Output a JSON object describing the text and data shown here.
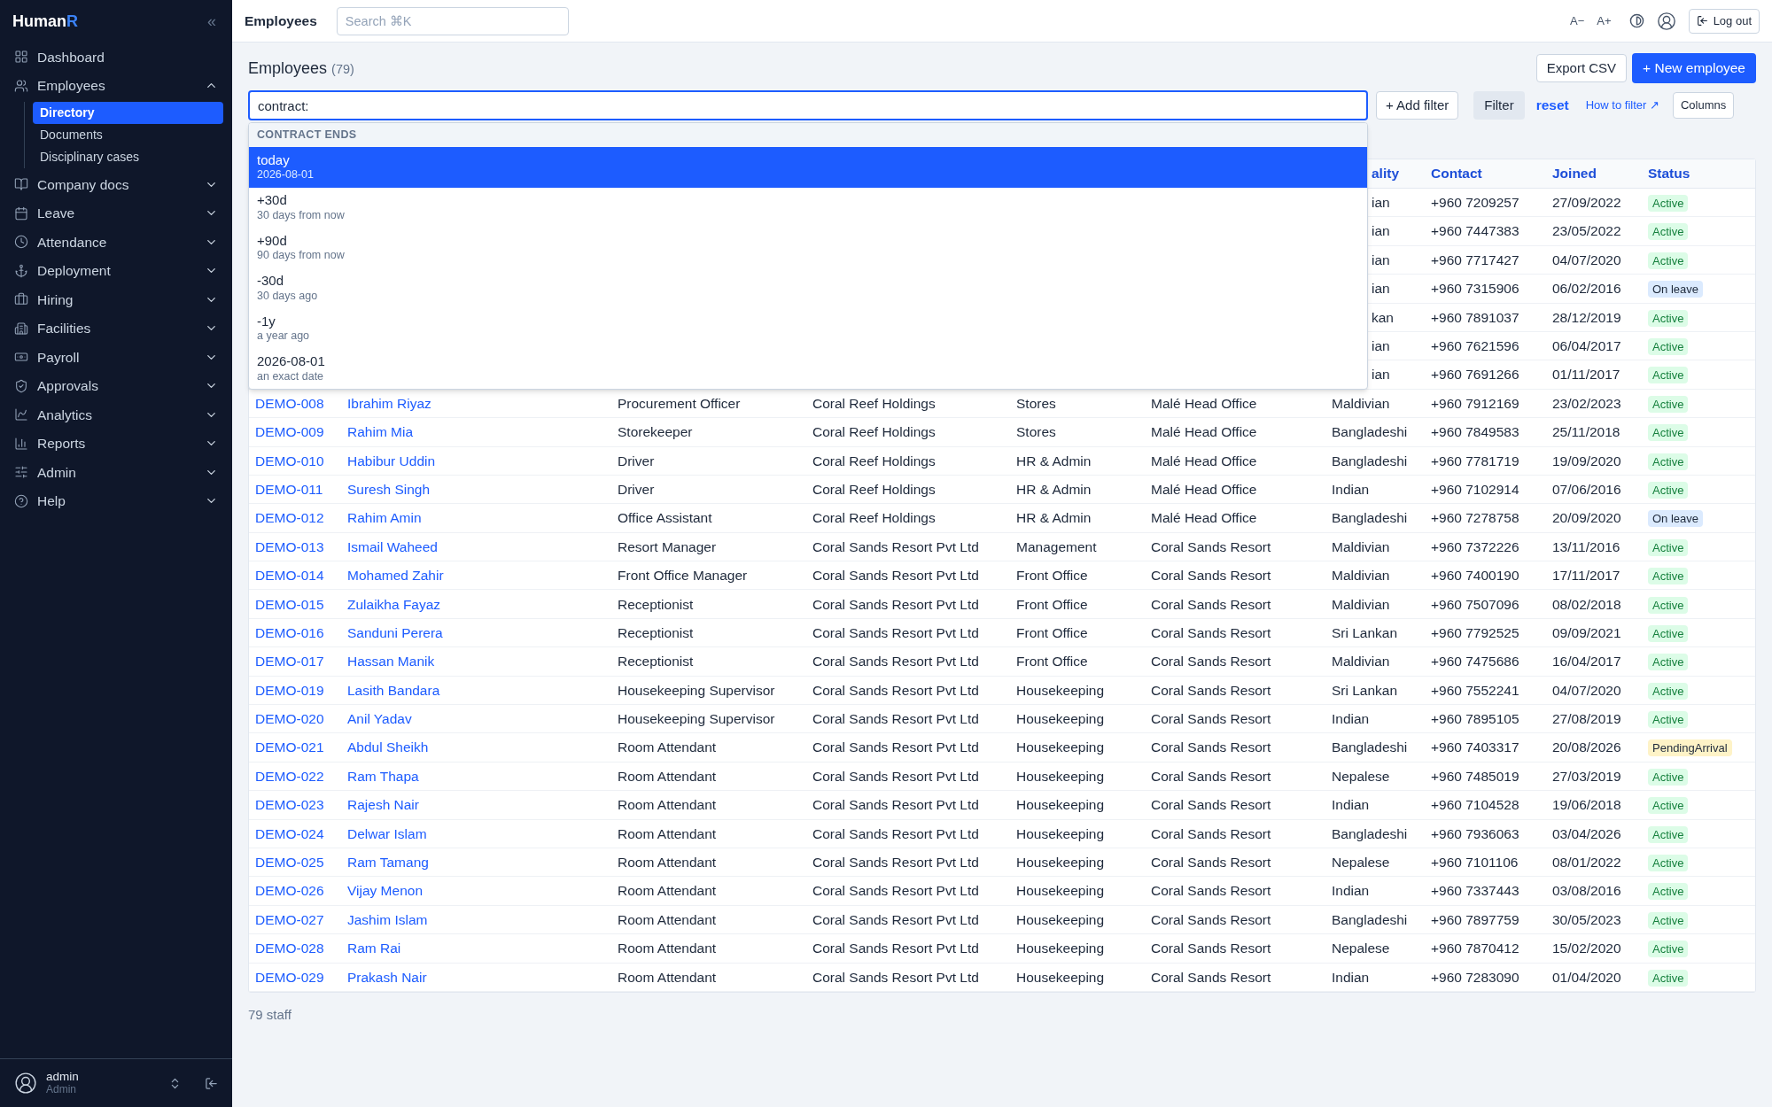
{
  "app": {
    "logo_main": "Human",
    "logo_accent": "R",
    "collapse": "«"
  },
  "sidebar": {
    "items": [
      {
        "label": "Dashboard"
      },
      {
        "label": "Employees",
        "expanded": true,
        "children": [
          {
            "label": "Directory",
            "selected": true
          },
          {
            "label": "Documents",
            "selected": false
          },
          {
            "label": "Disciplinary cases",
            "selected": false
          }
        ]
      },
      {
        "label": "Company docs",
        "expanded": false
      },
      {
        "label": "Leave",
        "expanded": false
      },
      {
        "label": "Attendance",
        "expanded": false
      },
      {
        "label": "Deployment",
        "expanded": false
      },
      {
        "label": "Hiring",
        "expanded": false
      },
      {
        "label": "Facilities",
        "expanded": false
      },
      {
        "label": "Payroll",
        "expanded": false
      },
      {
        "label": "Approvals",
        "expanded": false
      },
      {
        "label": "Analytics",
        "expanded": false
      },
      {
        "label": "Reports",
        "expanded": false
      },
      {
        "label": "Admin",
        "expanded": false
      },
      {
        "label": "Help",
        "expanded": false
      }
    ],
    "user": {
      "name": "admin",
      "role": "Admin"
    }
  },
  "topbar": {
    "title": "Employees",
    "search": {
      "placeholder": "Search ⌘K"
    },
    "font_down": "A−",
    "font_up": "A+",
    "logout": "Log out"
  },
  "page": {
    "title": "Employees",
    "count": "(79)",
    "export": "Export CSV",
    "new": "+ New employee"
  },
  "filter": {
    "value": "contract:",
    "add": "+ Add filter",
    "apply": "Filter",
    "reset": "reset",
    "help": "How to filter ↗",
    "columns": "Columns"
  },
  "suggestions": {
    "heading": "CONTRACT ENDS",
    "items": [
      {
        "label": "today",
        "hint": "2026-08-01",
        "selected": true
      },
      {
        "label": "+30d",
        "hint": "30 days from now",
        "selected": false
      },
      {
        "label": "+90d",
        "hint": "90 days from now",
        "selected": false
      },
      {
        "label": "-30d",
        "hint": "30 days ago",
        "selected": false
      },
      {
        "label": "-1y",
        "hint": "a year ago",
        "selected": false
      },
      {
        "label": "2026-08-01",
        "hint": "an exact date",
        "selected": false
      }
    ]
  },
  "table": {
    "columns": {
      "nationality": "ality",
      "contact": "Contact",
      "joined": "Joined",
      "status": "Status"
    },
    "rows": [
      {
        "nationality": "ian",
        "contact": "+960 7209257",
        "joined": "27/09/2022",
        "status": "Active",
        "kind": "active"
      },
      {
        "nationality": "ian",
        "contact": "+960 7447383",
        "joined": "23/05/2022",
        "status": "Active",
        "kind": "active"
      },
      {
        "nationality": "ian",
        "contact": "+960 7717427",
        "joined": "04/07/2020",
        "status": "Active",
        "kind": "active"
      },
      {
        "nationality": "ian",
        "contact": "+960 7315906",
        "joined": "06/02/2016",
        "status": "On leave",
        "kind": "leave"
      },
      {
        "nationality": "kan",
        "contact": "+960 7891037",
        "joined": "28/12/2019",
        "status": "Active",
        "kind": "active"
      },
      {
        "nationality": "ian",
        "contact": "+960 7621596",
        "joined": "06/04/2017",
        "status": "Active",
        "kind": "active"
      },
      {
        "nationality": "ian",
        "contact": "+960 7691266",
        "joined": "01/11/2017",
        "status": "Active",
        "kind": "active"
      },
      {
        "id": "DEMO-008",
        "name": "Ibrahim Riyaz",
        "title": "Procurement Officer",
        "company": "Coral Reef Holdings",
        "department": "Stores",
        "location": "Malé Head Office",
        "nationality": "Maldivian",
        "contact": "+960 7912169",
        "joined": "23/02/2023",
        "status": "Active",
        "kind": "active"
      },
      {
        "id": "DEMO-009",
        "name": "Rahim Mia",
        "title": "Storekeeper",
        "company": "Coral Reef Holdings",
        "department": "Stores",
        "location": "Malé Head Office",
        "nationality": "Bangladeshi",
        "contact": "+960 7849583",
        "joined": "25/11/2018",
        "status": "Active",
        "kind": "active"
      },
      {
        "id": "DEMO-010",
        "name": "Habibur Uddin",
        "title": "Driver",
        "company": "Coral Reef Holdings",
        "department": "HR & Admin",
        "location": "Malé Head Office",
        "nationality": "Bangladeshi",
        "contact": "+960 7781719",
        "joined": "19/09/2020",
        "status": "Active",
        "kind": "active"
      },
      {
        "id": "DEMO-011",
        "name": "Suresh Singh",
        "title": "Driver",
        "company": "Coral Reef Holdings",
        "department": "HR & Admin",
        "location": "Malé Head Office",
        "nationality": "Indian",
        "contact": "+960 7102914",
        "joined": "07/06/2016",
        "status": "Active",
        "kind": "active"
      },
      {
        "id": "DEMO-012",
        "name": "Rahim Amin",
        "title": "Office Assistant",
        "company": "Coral Reef Holdings",
        "department": "HR & Admin",
        "location": "Malé Head Office",
        "nationality": "Bangladeshi",
        "contact": "+960 7278758",
        "joined": "20/09/2020",
        "status": "On leave",
        "kind": "leave"
      },
      {
        "id": "DEMO-013",
        "name": "Ismail Waheed",
        "title": "Resort Manager",
        "company": "Coral Sands Resort Pvt Ltd",
        "department": "Management",
        "location": "Coral Sands Resort",
        "nationality": "Maldivian",
        "contact": "+960 7372226",
        "joined": "13/11/2016",
        "status": "Active",
        "kind": "active"
      },
      {
        "id": "DEMO-014",
        "name": "Mohamed Zahir",
        "title": "Front Office Manager",
        "company": "Coral Sands Resort Pvt Ltd",
        "department": "Front Office",
        "location": "Coral Sands Resort",
        "nationality": "Maldivian",
        "contact": "+960 7400190",
        "joined": "17/11/2017",
        "status": "Active",
        "kind": "active"
      },
      {
        "id": "DEMO-015",
        "name": "Zulaikha Fayaz",
        "title": "Receptionist",
        "company": "Coral Sands Resort Pvt Ltd",
        "department": "Front Office",
        "location": "Coral Sands Resort",
        "nationality": "Maldivian",
        "contact": "+960 7507096",
        "joined": "08/02/2018",
        "status": "Active",
        "kind": "active"
      },
      {
        "id": "DEMO-016",
        "name": "Sanduni Perera",
        "title": "Receptionist",
        "company": "Coral Sands Resort Pvt Ltd",
        "department": "Front Office",
        "location": "Coral Sands Resort",
        "nationality": "Sri Lankan",
        "contact": "+960 7792525",
        "joined": "09/09/2021",
        "status": "Active",
        "kind": "active"
      },
      {
        "id": "DEMO-017",
        "name": "Hassan Manik",
        "title": "Receptionist",
        "company": "Coral Sands Resort Pvt Ltd",
        "department": "Front Office",
        "location": "Coral Sands Resort",
        "nationality": "Maldivian",
        "contact": "+960 7475686",
        "joined": "16/04/2017",
        "status": "Active",
        "kind": "active"
      },
      {
        "id": "DEMO-019",
        "name": "Lasith Bandara",
        "title": "Housekeeping Supervisor",
        "company": "Coral Sands Resort Pvt Ltd",
        "department": "Housekeeping",
        "location": "Coral Sands Resort",
        "nationality": "Sri Lankan",
        "contact": "+960 7552241",
        "joined": "04/07/2020",
        "status": "Active",
        "kind": "active"
      },
      {
        "id": "DEMO-020",
        "name": "Anil Yadav",
        "title": "Housekeeping Supervisor",
        "company": "Coral Sands Resort Pvt Ltd",
        "department": "Housekeeping",
        "location": "Coral Sands Resort",
        "nationality": "Indian",
        "contact": "+960 7895105",
        "joined": "27/08/2019",
        "status": "Active",
        "kind": "active"
      },
      {
        "id": "DEMO-021",
        "name": "Abdul Sheikh",
        "title": "Room Attendant",
        "company": "Coral Sands Resort Pvt Ltd",
        "department": "Housekeeping",
        "location": "Coral Sands Resort",
        "nationality": "Bangladeshi",
        "contact": "+960 7403317",
        "joined": "20/08/2026",
        "status": "PendingArrival",
        "kind": "pending"
      },
      {
        "id": "DEMO-022",
        "name": "Ram Thapa",
        "title": "Room Attendant",
        "company": "Coral Sands Resort Pvt Ltd",
        "department": "Housekeeping",
        "location": "Coral Sands Resort",
        "nationality": "Nepalese",
        "contact": "+960 7485019",
        "joined": "27/03/2019",
        "status": "Active",
        "kind": "active"
      },
      {
        "id": "DEMO-023",
        "name": "Rajesh Nair",
        "title": "Room Attendant",
        "company": "Coral Sands Resort Pvt Ltd",
        "department": "Housekeeping",
        "location": "Coral Sands Resort",
        "nationality": "Indian",
        "contact": "+960 7104528",
        "joined": "19/06/2018",
        "status": "Active",
        "kind": "active"
      },
      {
        "id": "DEMO-024",
        "name": "Delwar Islam",
        "title": "Room Attendant",
        "company": "Coral Sands Resort Pvt Ltd",
        "department": "Housekeeping",
        "location": "Coral Sands Resort",
        "nationality": "Bangladeshi",
        "contact": "+960 7936063",
        "joined": "03/04/2026",
        "status": "Active",
        "kind": "active"
      },
      {
        "id": "DEMO-025",
        "name": "Ram Tamang",
        "title": "Room Attendant",
        "company": "Coral Sands Resort Pvt Ltd",
        "department": "Housekeeping",
        "location": "Coral Sands Resort",
        "nationality": "Nepalese",
        "contact": "+960 7101106",
        "joined": "08/01/2022",
        "status": "Active",
        "kind": "active"
      },
      {
        "id": "DEMO-026",
        "name": "Vijay Menon",
        "title": "Room Attendant",
        "company": "Coral Sands Resort Pvt Ltd",
        "department": "Housekeeping",
        "location": "Coral Sands Resort",
        "nationality": "Indian",
        "contact": "+960 7337443",
        "joined": "03/08/2016",
        "status": "Active",
        "kind": "active"
      },
      {
        "id": "DEMO-027",
        "name": "Jashim Islam",
        "title": "Room Attendant",
        "company": "Coral Sands Resort Pvt Ltd",
        "department": "Housekeeping",
        "location": "Coral Sands Resort",
        "nationality": "Bangladeshi",
        "contact": "+960 7897759",
        "joined": "30/05/2023",
        "status": "Active",
        "kind": "active"
      },
      {
        "id": "DEMO-028",
        "name": "Ram Rai",
        "title": "Room Attendant",
        "company": "Coral Sands Resort Pvt Ltd",
        "department": "Housekeeping",
        "location": "Coral Sands Resort",
        "nationality": "Nepalese",
        "contact": "+960 7870412",
        "joined": "15/02/2020",
        "status": "Active",
        "kind": "active"
      },
      {
        "id": "DEMO-029",
        "name": "Prakash Nair",
        "title": "Room Attendant",
        "company": "Coral Sands Resort Pvt Ltd",
        "department": "Housekeeping",
        "location": "Coral Sands Resort",
        "nationality": "Indian",
        "contact": "+960 7283090",
        "joined": "01/04/2020",
        "status": "Active",
        "kind": "active"
      }
    ]
  },
  "footer": "79 staff"
}
